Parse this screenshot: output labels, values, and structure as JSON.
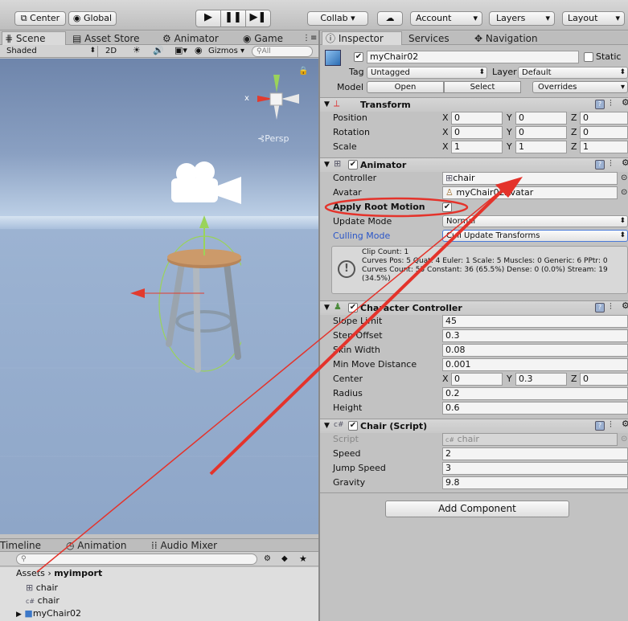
{
  "toolbar": {
    "center": "Center",
    "global": "Global",
    "collab": "Collab",
    "account": "Account",
    "layers": "Layers",
    "layout": "Layout"
  },
  "scene_tabs": {
    "scene": "Scene",
    "asset_store": "Asset Store",
    "animator": "Animator",
    "game": "Game"
  },
  "scene_bar": {
    "shading": "Shaded",
    "mode_2d": "2D",
    "gizmos": "Gizmos",
    "search_placeholder": "All"
  },
  "gizmo": {
    "x_label": "x",
    "persp_label": "Persp"
  },
  "inspector_tabs": {
    "inspector": "Inspector",
    "services": "Services",
    "navigation": "Navigation"
  },
  "object": {
    "name": "myChair02",
    "static_label": "Static",
    "tag_label": "Tag",
    "tag_value": "Untagged",
    "layer_label": "Layer",
    "layer_value": "Default",
    "model_label": "Model",
    "open": "Open",
    "select": "Select",
    "overrides": "Overrides"
  },
  "transform": {
    "title": "Transform",
    "rows": [
      {
        "label": "Position",
        "x": "0",
        "y": "0",
        "z": "0"
      },
      {
        "label": "Rotation",
        "x": "0",
        "y": "0",
        "z": "0"
      },
      {
        "label": "Scale",
        "x": "1",
        "y": "1",
        "z": "1"
      }
    ]
  },
  "axes": {
    "x": "X",
    "y": "Y",
    "z": "Z"
  },
  "animator_comp": {
    "title": "Animator",
    "controller_label": "Controller",
    "controller_value": "chair",
    "avatar_label": "Avatar",
    "avatar_value": "myChair02Avatar",
    "root_motion_label": "Apply Root Motion",
    "update_mode_label": "Update Mode",
    "update_mode_value": "Normal",
    "culling_label": "Culling Mode",
    "culling_value": "Cull Update Transforms",
    "info_lines": [
      "Clip Count: 1",
      "Curves Pos: 5 Quat: 4 Euler: 1 Scale: 5 Muscles: 0 Generic: 6 PPtr: 0",
      "Curves Count: 55 Constant: 36 (65.5%) Dense: 0 (0.0%) Stream: 19",
      "(34.5%)"
    ]
  },
  "character_controller": {
    "title": "Character Controller",
    "rows": [
      {
        "label": "Slope Limit",
        "value": "45"
      },
      {
        "label": "Step Offset",
        "value": "0.3"
      },
      {
        "label": "Skin Width",
        "value": "0.08"
      },
      {
        "label": "Min Move Distance",
        "value": "0.001"
      }
    ],
    "center_label": "Center",
    "center": {
      "x": "0",
      "y": "0.3",
      "z": "0"
    },
    "radius_label": "Radius",
    "radius": "0.2",
    "height_label": "Height",
    "height": "0.6"
  },
  "chair_script": {
    "title": "Chair (Script)",
    "script_label": "Script",
    "script_value": "chair",
    "rows": [
      {
        "label": "Speed",
        "value": "2"
      },
      {
        "label": "Jump Speed",
        "value": "3"
      },
      {
        "label": "Gravity",
        "value": "9.8"
      }
    ]
  },
  "add_component": "Add Component",
  "bottom_tabs": {
    "timeline": "Timeline",
    "animation": "Animation",
    "audio_mixer": "Audio Mixer"
  },
  "project": {
    "breadcrumb_root": "Assets",
    "breadcrumb_folder": "myimport",
    "items": [
      "chair",
      "chair",
      "myChair02"
    ]
  },
  "colors": {
    "annotation_red": "#e4332b",
    "link_blue": "#2a55c8",
    "sky_top": "#6e85ab",
    "ground": "#8ea6c8"
  }
}
